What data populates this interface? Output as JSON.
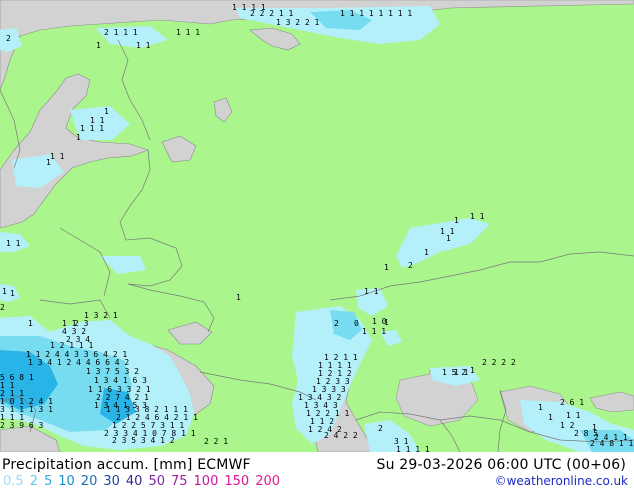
{
  "title": "Precipitation accum. [mm] ECMWF",
  "valid_time": "Su 29-03-2026 06:00 UTC (00+06)",
  "credit": "©weatheronline.co.uk",
  "colors": {
    "land": "#aaf58c",
    "sea": "#d2d2d2",
    "precip_light": "#b4f0fa",
    "precip_mid": "#78dcf0",
    "precip_heavy": "#28b4e6"
  },
  "scale": [
    {
      "label": "0.5",
      "color": "#96dcfa"
    },
    {
      "label": "2",
      "color": "#64c8f0"
    },
    {
      "label": "5",
      "color": "#32aae6"
    },
    {
      "label": "10",
      "color": "#1e8ccd"
    },
    {
      "label": "20",
      "color": "#1e6eb4"
    },
    {
      "label": "30",
      "color": "#1e46a0"
    },
    {
      "label": "40",
      "color": "#3c288c"
    },
    {
      "label": "50",
      "color": "#7828a0"
    },
    {
      "label": "75",
      "color": "#a01ea0"
    },
    {
      "label": "100",
      "color": "#c814a0"
    },
    {
      "label": "150",
      "color": "#dc1496"
    },
    {
      "label": "200",
      "color": "#e61e8c"
    }
  ],
  "grid_labels": [
    "1 1 1 1",
    "2 2 2 1 1",
    "1 3 2 2 1",
    "1 1 1 1 1 1 1 1",
    "2 1 1 1",
    "1 1 1",
    "2",
    "1",
    "1 1",
    "1",
    "1 1",
    "1 1 1",
    "1",
    "1 1",
    "1",
    "1 1",
    "1",
    "1 1",
    "1 1",
    "1",
    "1",
    "1",
    "1",
    "2",
    "1",
    "1",
    "1 1",
    "2",
    "1",
    "1 1",
    "1 3 2 1",
    "2 3",
    "4 3 2",
    "2 3 4",
    "1 2 1 1 1",
    "1 1 2 4 4 3 3 6 4 2 1",
    "1 3 4 1 2 4 4 6 6 4 2",
    "1 3 7 5 3 2",
    "1 3 4 1 6 3",
    "1 1 6 3 3 2 1",
    "2 2 7 4 2 1",
    "1 3 4 1 5 3",
    "1 1 3 3 8 2 1 1 1",
    "2 1 2 4 6 4 2 1 1",
    "1 2 2 5 7 3 1 1",
    "2 3 3 4 1 0 7 8 1 1",
    "2 3 5 3 4 1 2",
    "2 2 1",
    "2",
    "0",
    "1 1 1",
    "1 0",
    "1",
    "1 2 1 1",
    "1 1 1 1",
    "1 2 1 2",
    "1 2 3 3",
    "1 3 3 3",
    "1 3 4 3 2",
    "1 3 4 3",
    "1 2 2 1 1",
    "1 1 2",
    "1 2 4 2",
    "2 4 2 2",
    "1 5 2",
    "1 1",
    "2",
    "3 1",
    "1 1 1 1",
    "2 6 1",
    "1 1",
    "1 2",
    "2 8 5",
    "2 4 1 1",
    "2 4 8 1 1",
    "5 6 8 1",
    "1 1",
    "2 1 1",
    "1 0 1 2 4 1",
    "3 1 1 1 3 1",
    "1 1 1",
    "2 3 9 6 3",
    "2 2 2 2",
    "1",
    "1",
    "1",
    "1",
    "1 1 1"
  ]
}
